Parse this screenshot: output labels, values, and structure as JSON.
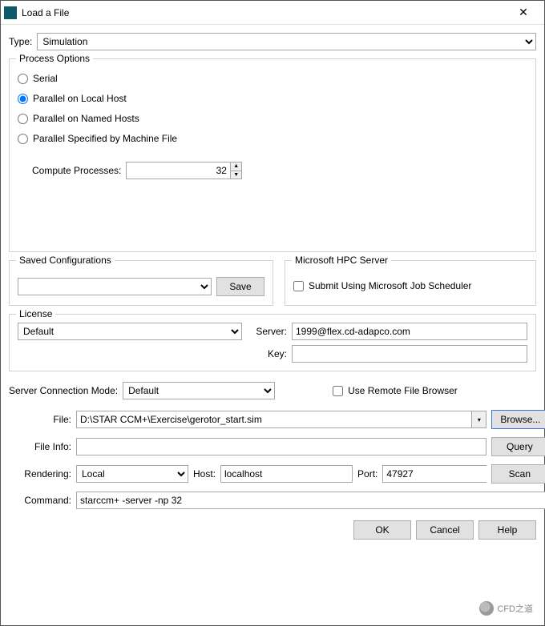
{
  "window": {
    "title": "Load a File"
  },
  "type": {
    "label": "Type:",
    "value": "Simulation"
  },
  "process_options": {
    "legend": "Process Options",
    "radios": {
      "serial": "Serial",
      "parallel_local": "Parallel on Local Host",
      "parallel_named": "Parallel on Named Hosts",
      "parallel_machine": "Parallel Specified by Machine File"
    },
    "selected": "parallel_local",
    "compute_label": "Compute Processes:",
    "compute_value": "32"
  },
  "saved_configs": {
    "legend": "Saved Configurations",
    "value": "",
    "save_btn": "Save"
  },
  "hpc": {
    "legend": "Microsoft HPC Server",
    "checkbox_label": "Submit Using Microsoft Job Scheduler",
    "checked": false
  },
  "license": {
    "legend": "License",
    "mode": "Default",
    "server_label": "Server:",
    "server_value": "1999@flex.cd-adapco.com",
    "key_label": "Key:",
    "key_value": ""
  },
  "conn_mode": {
    "label": "Server Connection Mode:",
    "value": "Default",
    "remote_checkbox": "Use Remote File Browser",
    "remote_checked": false
  },
  "file": {
    "label": "File:",
    "value": "D:\\STAR CCM+\\Exercise\\gerotor_start.sim",
    "browse_btn": "Browse..."
  },
  "file_info": {
    "label": "File Info:",
    "value": "",
    "query_btn": "Query"
  },
  "rendering": {
    "label": "Rendering:",
    "value": "Local",
    "host_label": "Host:",
    "host_value": "localhost",
    "port_label": "Port:",
    "port_value": "47927",
    "scan_btn": "Scan"
  },
  "command": {
    "label": "Command:",
    "value": "starccm+ -server -np 32"
  },
  "footer": {
    "ok": "OK",
    "cancel": "Cancel",
    "help": "Help"
  },
  "watermark": "CFD之道"
}
